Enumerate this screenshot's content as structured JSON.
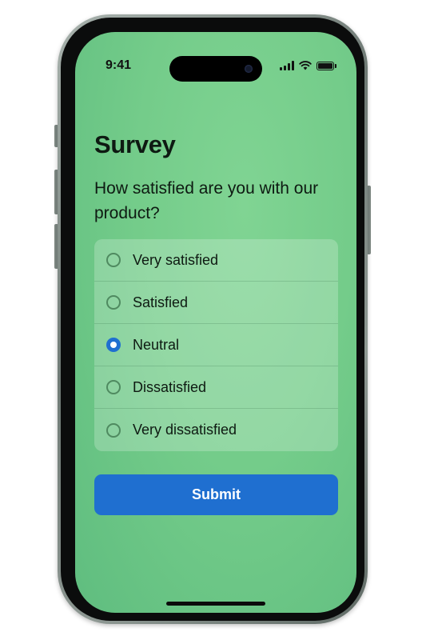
{
  "status_bar": {
    "time": "9:41"
  },
  "survey": {
    "title": "Survey",
    "question": "How satisfied are you with our product?",
    "options": [
      {
        "label": "Very satisfied",
        "selected": false
      },
      {
        "label": "Satisfied",
        "selected": false
      },
      {
        "label": "Neutral",
        "selected": true
      },
      {
        "label": "Dissatisfied",
        "selected": false
      },
      {
        "label": "Very dissatisfied",
        "selected": false
      }
    ],
    "submit_label": "Submit"
  },
  "colors": {
    "background_green": "#74cc8a",
    "accent_blue": "#1f6fd0",
    "text": "#0e1a12"
  },
  "icons": {
    "signal": "cellular-signal-icon",
    "wifi": "wifi-icon",
    "battery": "battery-icon"
  }
}
